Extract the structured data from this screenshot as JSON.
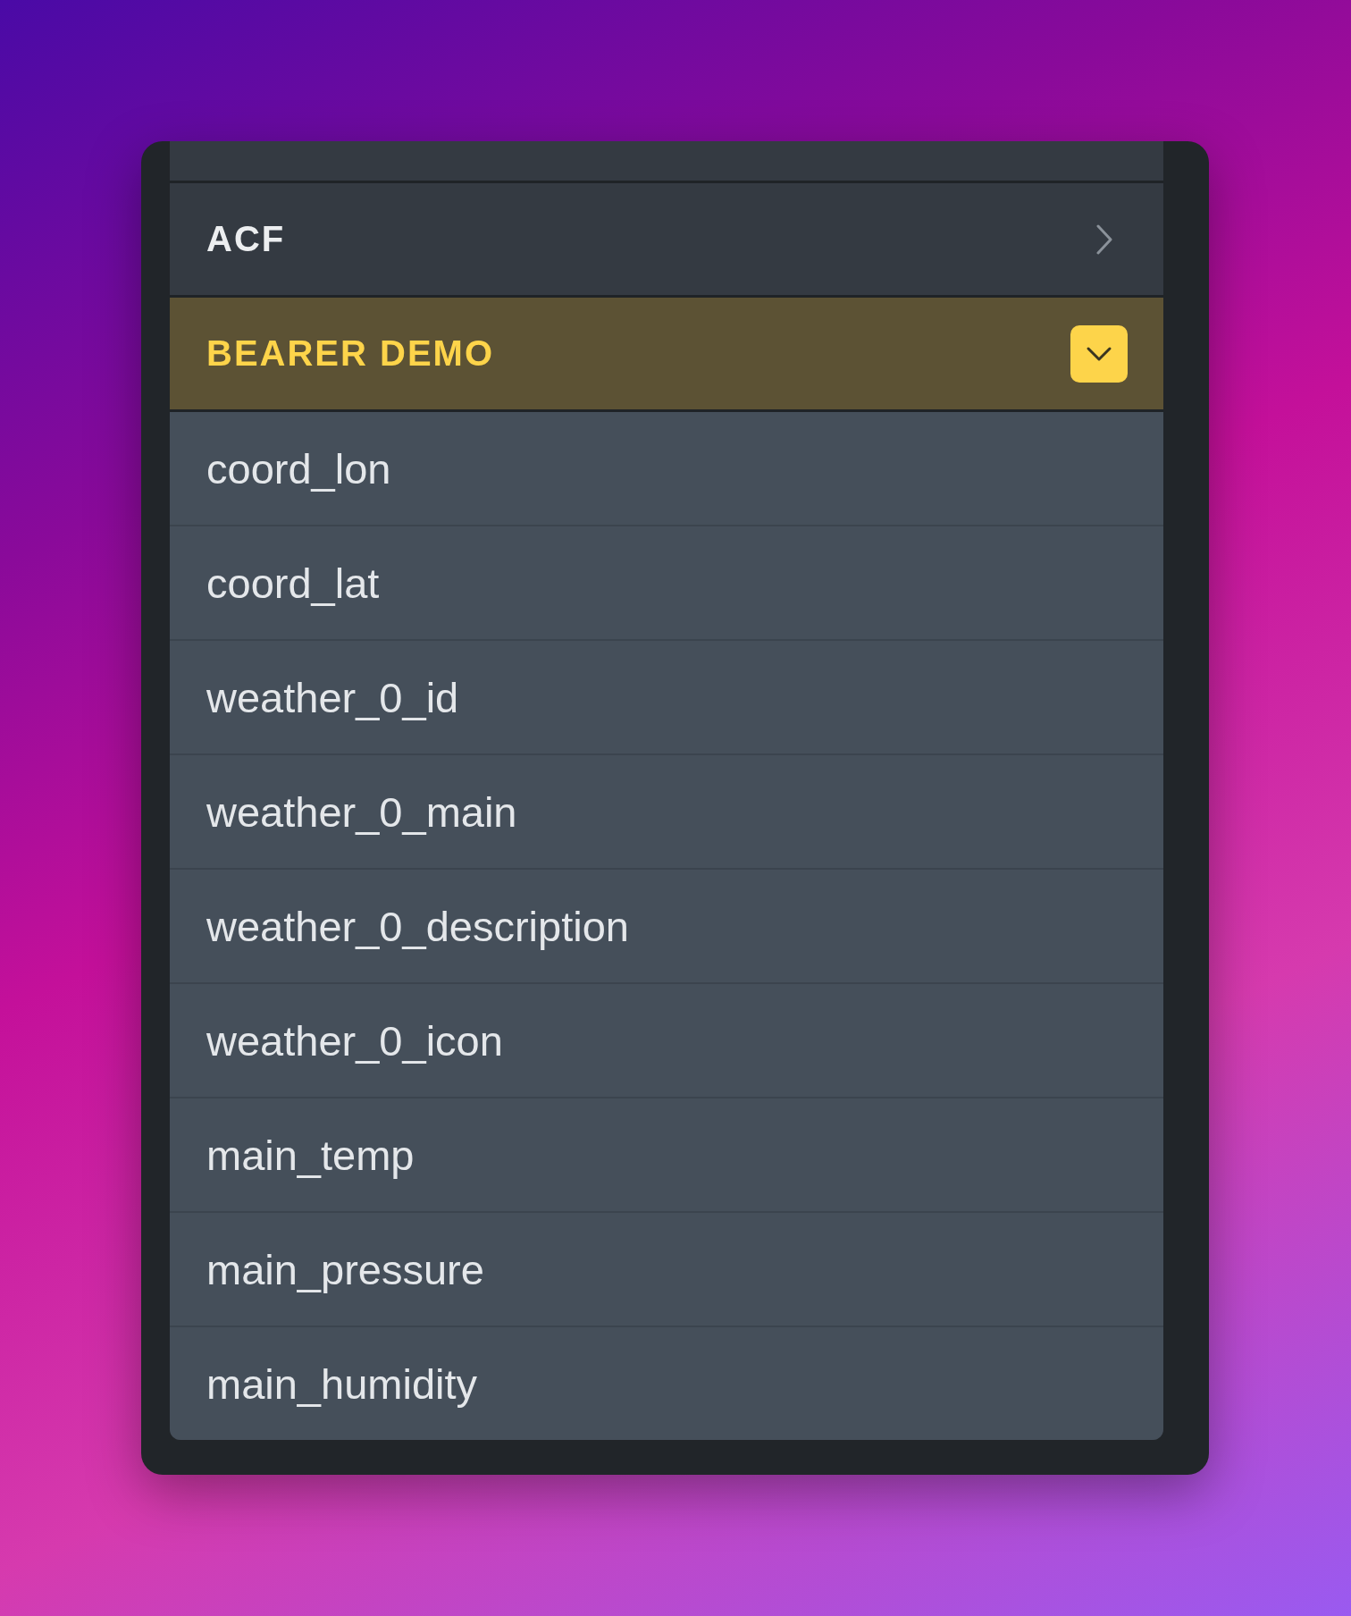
{
  "groups": [
    {
      "label": "ACF",
      "expanded": false
    },
    {
      "label": "BEARER DEMO",
      "expanded": true,
      "fields": [
        "coord_lon",
        "coord_lat",
        "weather_0_id",
        "weather_0_main",
        "weather_0_description",
        "weather_0_icon",
        "main_temp",
        "main_pressure",
        "main_humidity"
      ]
    }
  ]
}
